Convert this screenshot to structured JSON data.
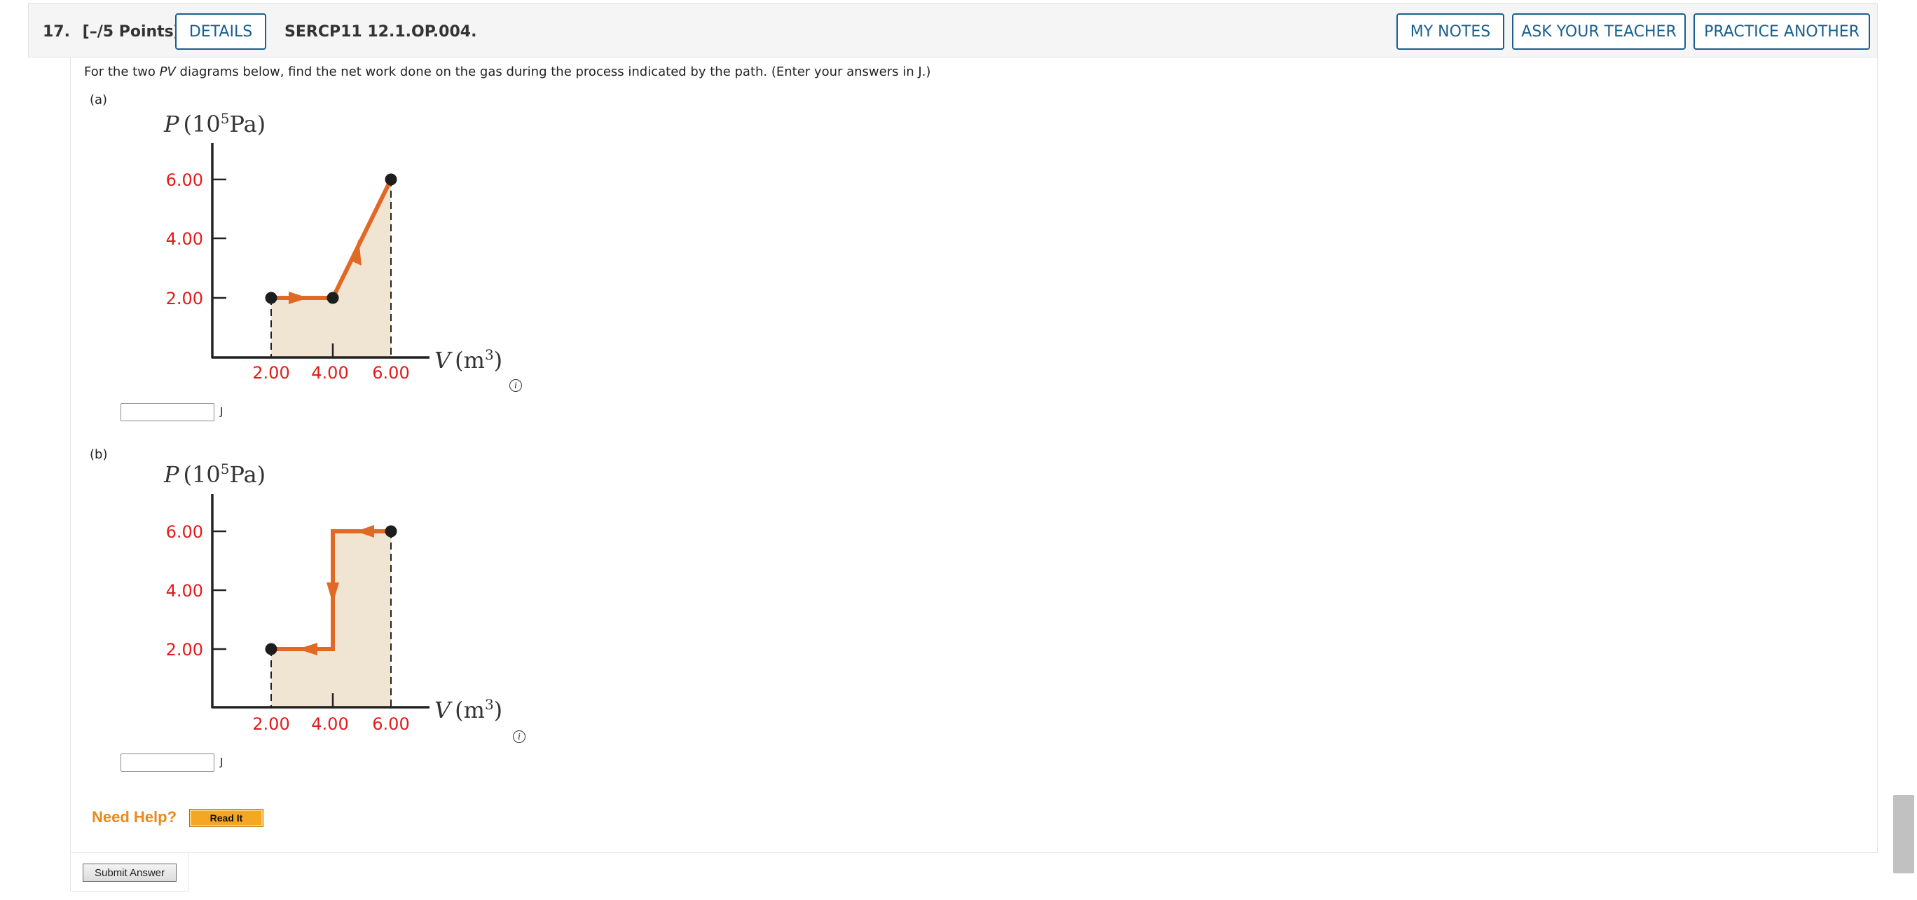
{
  "header": {
    "question_number": "17.",
    "points": "[–/5 Points]",
    "details_label": "DETAILS",
    "question_code": "SERCP11 12.1.OP.004.",
    "my_notes_label": "MY NOTES",
    "ask_teacher_label": "ASK YOUR TEACHER",
    "practice_another_label": "PRACTICE ANOTHER"
  },
  "prompt": {
    "before": "For the two ",
    "emphasis": "PV",
    "after": " diagrams below, find the net work done on the gas during the process indicated by the path. (Enter your answers in J.)"
  },
  "parts": [
    {
      "label": "(a)",
      "answer_value": "",
      "unit": "J"
    },
    {
      "label": "(b)",
      "answer_value": "",
      "unit": "J"
    }
  ],
  "diagram_text": {
    "y_axis_P": "P",
    "y_axis_unit_open": "(10",
    "y_axis_unit_exp": "5",
    "y_axis_unit_close": "Pa)",
    "x_axis_V": "V",
    "x_axis_unit_open": "(m",
    "x_axis_unit_exp": "3",
    "x_axis_unit_close": ")",
    "y_ticks": [
      "2.00",
      "4.00",
      "6.00"
    ],
    "x_ticks": [
      "2.00",
      "4.00",
      "6.00"
    ],
    "info_symbol": "i"
  },
  "help": {
    "need_help_label": "Need Help?",
    "read_it_label": "Read It"
  },
  "submit_label": "Submit Answer",
  "colors": {
    "accent": "#1a5f8c",
    "path": "#e06a25",
    "shade": "#f0e4d2",
    "tick_label": "#e21b1b",
    "help": "#e98a1d"
  }
}
